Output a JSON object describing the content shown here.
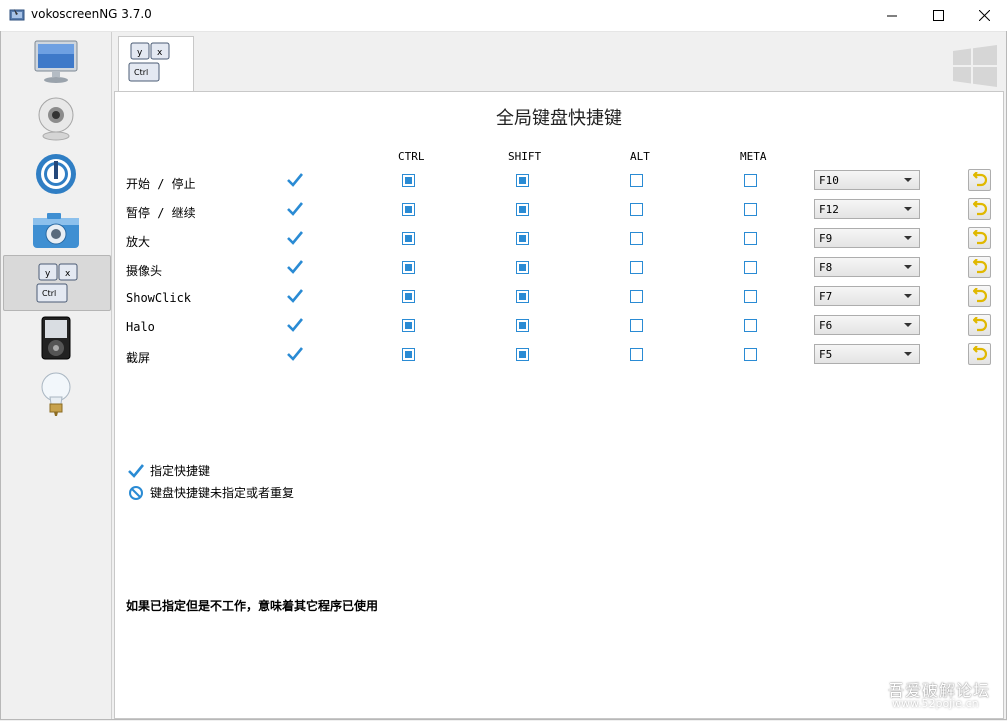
{
  "window": {
    "title": "vokoscreenNG 3.7.0"
  },
  "sidebar": {
    "items": [
      {
        "icon": "monitor-icon"
      },
      {
        "icon": "webcam-icon"
      },
      {
        "icon": "power-ring-icon"
      },
      {
        "icon": "camera-icon"
      },
      {
        "icon": "keyboard-shortcut-icon",
        "active": true
      },
      {
        "icon": "media-player-icon"
      },
      {
        "icon": "lightbulb-icon"
      }
    ]
  },
  "tab": {
    "key_y": "y",
    "key_x": "x",
    "key_ctrl": "Ctrl"
  },
  "panel": {
    "heading": "全局键盘快捷键",
    "columns": {
      "ctrl": "CTRL",
      "shift": "SHIFT",
      "alt": "ALT",
      "meta": "META"
    },
    "rows": [
      {
        "label": "开始 / 停止",
        "ctrl": true,
        "shift": true,
        "alt": false,
        "meta": false,
        "key": "F10"
      },
      {
        "label": "暂停 / 继续",
        "ctrl": true,
        "shift": true,
        "alt": false,
        "meta": false,
        "key": "F12"
      },
      {
        "label": "放大",
        "ctrl": true,
        "shift": true,
        "alt": false,
        "meta": false,
        "key": "F9"
      },
      {
        "label": "摄像头",
        "ctrl": true,
        "shift": true,
        "alt": false,
        "meta": false,
        "key": "F8"
      },
      {
        "label": "ShowClick",
        "ctrl": true,
        "shift": true,
        "alt": false,
        "meta": false,
        "key": "F7"
      },
      {
        "label": "Halo",
        "ctrl": true,
        "shift": true,
        "alt": false,
        "meta": false,
        "key": "F6"
      },
      {
        "label": "截屏",
        "ctrl": true,
        "shift": true,
        "alt": false,
        "meta": false,
        "key": "F5"
      }
    ],
    "legend": {
      "assigned": "指定快捷键",
      "unassigned": "键盘快捷键未指定或者重复"
    },
    "notice": "如果已指定但是不工作，意味着其它程序已使用"
  },
  "watermark": {
    "line1": "吾爱破解论坛",
    "line2": "www.52pojie.cn"
  },
  "colors": {
    "accent": "#2a8bd4",
    "check": "#2a8bd4",
    "reset": "#e0b800"
  }
}
